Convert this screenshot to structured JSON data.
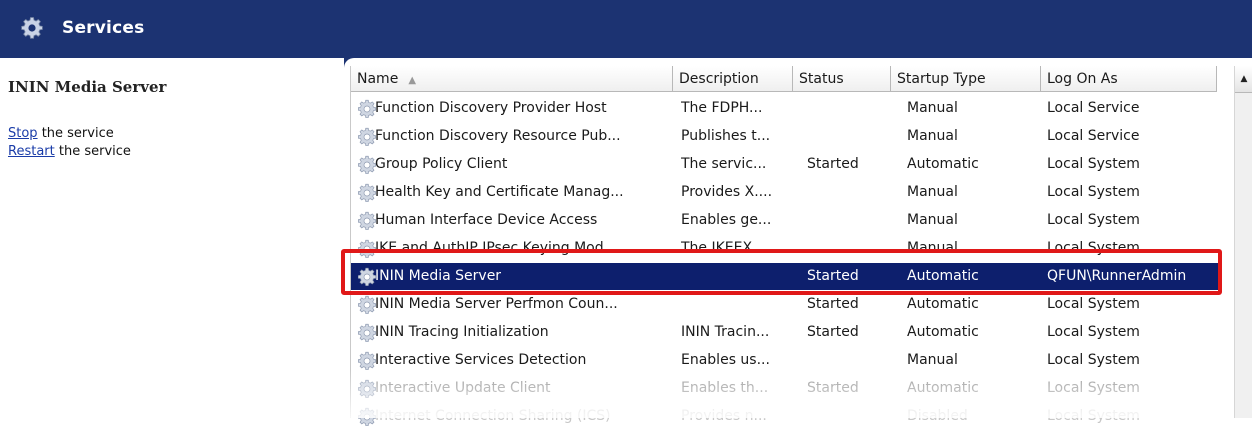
{
  "window": {
    "title": "Services",
    "title_icon": "gear-icon"
  },
  "left_pane": {
    "service_name": "ININ Media Server",
    "actions": [
      {
        "link": "Stop",
        "rest": " the service"
      },
      {
        "link": "Restart",
        "rest": " the service"
      }
    ]
  },
  "columns": [
    {
      "label": "Name",
      "sort": "ascending"
    },
    {
      "label": "Description"
    },
    {
      "label": "Status"
    },
    {
      "label": "Startup Type"
    },
    {
      "label": "Log On As"
    }
  ],
  "rows": [
    {
      "name": "Function Discovery Provider Host",
      "description": "The FDPH...",
      "status": "",
      "startup": "Manual",
      "logon": "Local Service"
    },
    {
      "name": "Function Discovery Resource Pub...",
      "description": "Publishes t...",
      "status": "",
      "startup": "Manual",
      "logon": "Local Service"
    },
    {
      "name": "Group Policy Client",
      "description": "The servic...",
      "status": "Started",
      "startup": "Automatic",
      "logon": "Local System"
    },
    {
      "name": "Health Key and Certificate Manag...",
      "description": "Provides X....",
      "status": "",
      "startup": "Manual",
      "logon": "Local System"
    },
    {
      "name": "Human Interface Device Access",
      "description": "Enables ge...",
      "status": "",
      "startup": "Manual",
      "logon": "Local System"
    },
    {
      "name": "IKE and AuthIP IPsec Keying Mod...",
      "description": "The IKEEX...",
      "status": "",
      "startup": "Manual",
      "logon": "Local System"
    },
    {
      "name": "ININ Media Server",
      "description": "",
      "status": "Started",
      "startup": "Automatic",
      "logon": "QFUN\\RunnerAdmin"
    },
    {
      "name": "ININ Media Server Perfmon Coun...",
      "description": "",
      "status": "Started",
      "startup": "Automatic",
      "logon": "Local System"
    },
    {
      "name": "ININ Tracing Initialization",
      "description": "ININ Tracin...",
      "status": "Started",
      "startup": "Automatic",
      "logon": "Local System"
    },
    {
      "name": "Interactive Services Detection",
      "description": "Enables us...",
      "status": "",
      "startup": "Manual",
      "logon": "Local System"
    },
    {
      "name": "Interactive Update Client",
      "description": "Enables th...",
      "status": "Started",
      "startup": "Automatic",
      "logon": "Local System"
    },
    {
      "name": "Internet Connection Sharing (ICS)",
      "description": "Provides n...",
      "status": "",
      "startup": "Disabled",
      "logon": "Local System"
    }
  ],
  "selected_row": 6,
  "colors": {
    "title_bar": "#1c3372",
    "selection": "#0d1f6d",
    "highlight_box": "#e01818"
  }
}
